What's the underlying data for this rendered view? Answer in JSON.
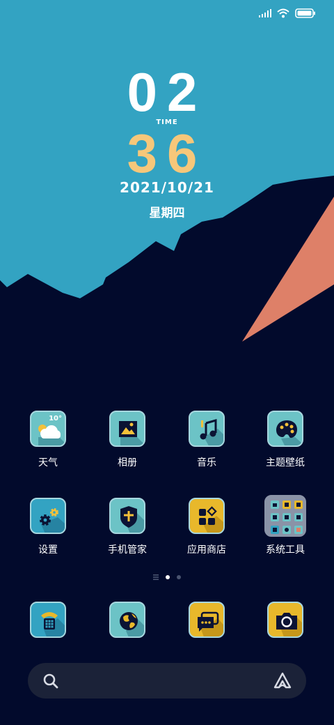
{
  "status_bar": {
    "signal_icon": "signal-bars-icon",
    "wifi_icon": "wifi-icon",
    "battery_icon": "battery-full-icon"
  },
  "clock": {
    "hour": "02",
    "time_label": "TIME",
    "minute": "36",
    "date": "2021/10/21",
    "weekday": "星期四"
  },
  "apps": [
    {
      "label": "天气",
      "icon": "weather-icon",
      "temperature": "10°"
    },
    {
      "label": "相册",
      "icon": "gallery-icon"
    },
    {
      "label": "音乐",
      "icon": "music-icon"
    },
    {
      "label": "主题壁纸",
      "icon": "themes-icon"
    },
    {
      "label": "设置",
      "icon": "settings-icon"
    },
    {
      "label": "手机管家",
      "icon": "security-icon"
    },
    {
      "label": "应用商店",
      "icon": "app-store-icon"
    },
    {
      "label": "系统工具",
      "icon": "system-tools-folder-icon"
    }
  ],
  "dock": [
    {
      "icon": "phone-icon"
    },
    {
      "icon": "browser-icon"
    },
    {
      "icon": "messages-icon"
    },
    {
      "icon": "camera-icon"
    }
  ],
  "page_indicator": {
    "pages": 2,
    "active": 1
  },
  "search_bar": {
    "icon": "search-icon",
    "assistant_icon": "assistant-icon"
  },
  "colors": {
    "sky": "#33a3c2",
    "night": "#020a2c",
    "accent_peach": "#de8068",
    "minute_yellow": "#f6c77a",
    "icon_teal": "#6cc3c6",
    "icon_yellow": "#e8b82b"
  }
}
